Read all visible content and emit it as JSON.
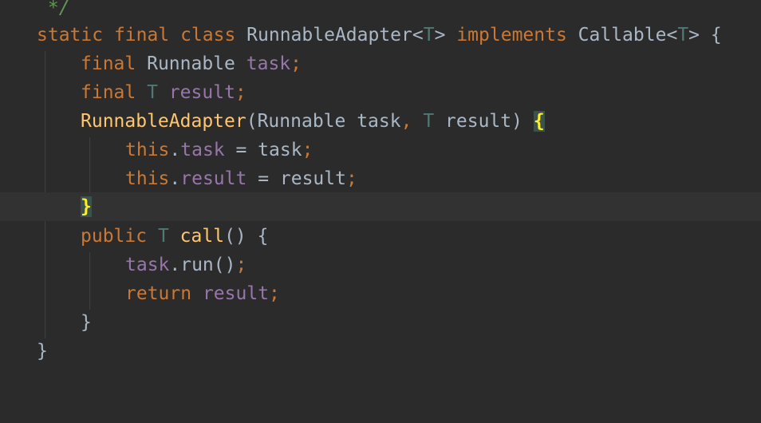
{
  "editor": {
    "lines": [
      {
        "tokens": [
          {
            "t": " */",
            "c": "cm"
          }
        ]
      },
      {
        "tokens": [
          {
            "t": "static",
            "c": "kw"
          },
          {
            "t": " ",
            "c": "pl"
          },
          {
            "t": "final",
            "c": "kw"
          },
          {
            "t": " ",
            "c": "pl"
          },
          {
            "t": "class",
            "c": "kw"
          },
          {
            "t": " ",
            "c": "pl"
          },
          {
            "t": "RunnableAdapter",
            "c": "cls"
          },
          {
            "t": "<",
            "c": "pl"
          },
          {
            "t": "T",
            "c": "tp"
          },
          {
            "t": ">",
            "c": "pl"
          },
          {
            "t": " ",
            "c": "pl"
          },
          {
            "t": "implements",
            "c": "kw"
          },
          {
            "t": " ",
            "c": "pl"
          },
          {
            "t": "Callable",
            "c": "cls"
          },
          {
            "t": "<",
            "c": "pl"
          },
          {
            "t": "T",
            "c": "tp"
          },
          {
            "t": ">",
            "c": "pl"
          },
          {
            "t": " {",
            "c": "pl"
          }
        ]
      },
      {
        "tokens": [
          {
            "t": "final",
            "c": "kw"
          },
          {
            "t": " ",
            "c": "pl"
          },
          {
            "t": "Runnable",
            "c": "cls"
          },
          {
            "t": " ",
            "c": "pl"
          },
          {
            "t": "task",
            "c": "fld"
          },
          {
            "t": ";",
            "c": "kw"
          }
        ]
      },
      {
        "tokens": [
          {
            "t": "final",
            "c": "kw"
          },
          {
            "t": " ",
            "c": "pl"
          },
          {
            "t": "T",
            "c": "tp"
          },
          {
            "t": " ",
            "c": "pl"
          },
          {
            "t": "result",
            "c": "fld"
          },
          {
            "t": ";",
            "c": "kw"
          }
        ]
      },
      {
        "tokens": [
          {
            "t": "RunnableAdapter",
            "c": "fn"
          },
          {
            "t": "(",
            "c": "pl"
          },
          {
            "t": "Runnable",
            "c": "cls"
          },
          {
            "t": " task",
            "c": "pl"
          },
          {
            "t": ",",
            "c": "kw"
          },
          {
            "t": " ",
            "c": "pl"
          },
          {
            "t": "T",
            "c": "tp"
          },
          {
            "t": " result",
            "c": "pl"
          },
          {
            "t": ") ",
            "c": "pl"
          },
          {
            "t": "{",
            "c": "brace-hl"
          }
        ]
      },
      {
        "tokens": [
          {
            "t": "this",
            "c": "kw"
          },
          {
            "t": ".",
            "c": "pl"
          },
          {
            "t": "task",
            "c": "fld"
          },
          {
            "t": " = task",
            "c": "pl"
          },
          {
            "t": ";",
            "c": "kw"
          }
        ]
      },
      {
        "tokens": [
          {
            "t": "this",
            "c": "kw"
          },
          {
            "t": ".",
            "c": "pl"
          },
          {
            "t": "result",
            "c": "fld"
          },
          {
            "t": " = result",
            "c": "pl"
          },
          {
            "t": ";",
            "c": "kw"
          }
        ]
      },
      {
        "tokens": [
          {
            "t": "}",
            "c": "brace-hl"
          }
        ]
      },
      {
        "tokens": [
          {
            "t": "public",
            "c": "kw"
          },
          {
            "t": " ",
            "c": "pl"
          },
          {
            "t": "T",
            "c": "tp"
          },
          {
            "t": " ",
            "c": "pl"
          },
          {
            "t": "call",
            "c": "fn"
          },
          {
            "t": "() {",
            "c": "pl"
          }
        ]
      },
      {
        "tokens": [
          {
            "t": "task",
            "c": "fld"
          },
          {
            "t": ".run()",
            "c": "pl"
          },
          {
            "t": ";",
            "c": "kw"
          }
        ]
      },
      {
        "tokens": [
          {
            "t": "return",
            "c": "kw"
          },
          {
            "t": " ",
            "c": "pl"
          },
          {
            "t": "result",
            "c": "fld"
          },
          {
            "t": ";",
            "c": "kw"
          }
        ]
      },
      {
        "tokens": [
          {
            "t": "}",
            "c": "pl"
          }
        ]
      },
      {
        "tokens": [
          {
            "t": "}",
            "c": "pl"
          }
        ]
      }
    ]
  },
  "colors": {
    "background": "#2b2b2b",
    "current_line": "#323232",
    "keyword": "#cc7832",
    "type_param": "#507874",
    "field": "#9876aa",
    "method": "#ffc66d",
    "comment": "#629755",
    "plain": "#a9b7c6",
    "brace_highlight": "#ffef28"
  }
}
